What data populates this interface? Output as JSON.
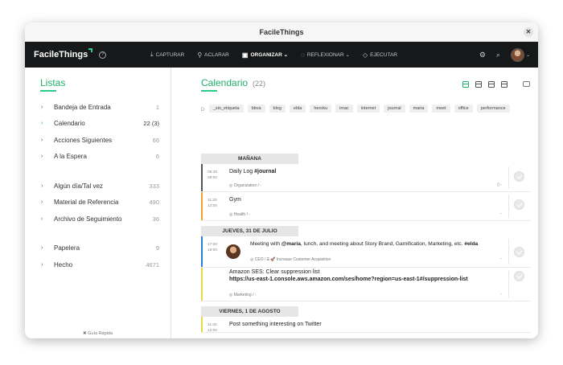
{
  "window": {
    "title": "FacileThings",
    "close": "✕"
  },
  "navbar": {
    "logo": "FacileThings",
    "help": "?",
    "items": [
      {
        "icon": "⤓",
        "label": "CAPTURAR"
      },
      {
        "icon": "⚲",
        "label": "ACLARAR"
      },
      {
        "icon": "▣",
        "label": "ORGANIZAR",
        "caret": "⌄"
      },
      {
        "icon": "◌",
        "label": "REFLEXIONAR",
        "caret": "⌄"
      },
      {
        "icon": "◇",
        "label": "EJECUTAR"
      }
    ],
    "settings_icon": "⚙",
    "search_icon": "⌕",
    "caret": "⌄"
  },
  "sidebar": {
    "title": "Listas",
    "group1": [
      {
        "label": "Bandeja de Entrada",
        "count": "1"
      },
      {
        "label": "Calendario",
        "count": "22 (3)",
        "active": true
      },
      {
        "label": "Acciones Siguientes",
        "count": "66"
      },
      {
        "label": "A la Espera",
        "count": "6"
      }
    ],
    "group2": [
      {
        "label": "Algún día/Tal vez",
        "count": "333"
      },
      {
        "label": "Material de Referencia",
        "count": "490"
      },
      {
        "label": "Archivo de Seguimiento",
        "count": "36"
      }
    ],
    "group3": [
      {
        "label": "Papelera",
        "count": "9"
      },
      {
        "label": "Hecho",
        "count": "4671"
      }
    ],
    "arrow": "›",
    "guide": "✖ Guía Rápida"
  },
  "main": {
    "title": "Calendario",
    "count": "(22)",
    "tags": [
      "_sin_etiqueta",
      "bbva",
      "blog",
      "elda",
      "heroku",
      "imac",
      "internet",
      "journal",
      "maria",
      "meet",
      "office",
      "performance"
    ],
    "sections": [
      {
        "header": "MAÑANA",
        "tasks": [
          {
            "time1": "08:45",
            "time2": "09:00",
            "title_pre": "Daily Log ",
            "title_bold": "#journal",
            "meta": "◎ Organization / -",
            "color": "#555555",
            "mini": "▯ ◦"
          },
          {
            "time1": "11:30",
            "time2": "12:00",
            "title_pre": "Gym",
            "title_bold": "",
            "meta": "◎ Health / -",
            "color": "#f0a030",
            "mini": "◦"
          }
        ]
      },
      {
        "header": "JUEVES, 31 DE JULIO",
        "tasks": [
          {
            "time1": "17:00",
            "time2": "18:00",
            "title_pre": "Meeting with ",
            "title_mention": "@maria",
            "title_post": ", lunch, and meeting about Story Brand, Gamification, Marketing, etc. ",
            "title_tag": "#elda",
            "meta": "◎ CEO / ⌸ 🚀 Increase Customer Acquisition",
            "color": "#2b7fd6",
            "mini": "◦"
          },
          {
            "title_pre": "Amazon SES: Clear suppression list",
            "title_line2": "https://us-east-1.console.aws.amazon.com/ses/home?region=us-east-1#/suppression-list",
            "meta": "◎ Marketing / -",
            "color": "#e6d84a",
            "mini": "◦"
          }
        ]
      },
      {
        "header": "VIERNES, 1 DE AGOSTO",
        "tasks": [
          {
            "time1": "11:30",
            "time2": "12:00",
            "title_pre": "Post something interesting on Twitter",
            "color": "#e6d84a"
          }
        ]
      }
    ]
  }
}
